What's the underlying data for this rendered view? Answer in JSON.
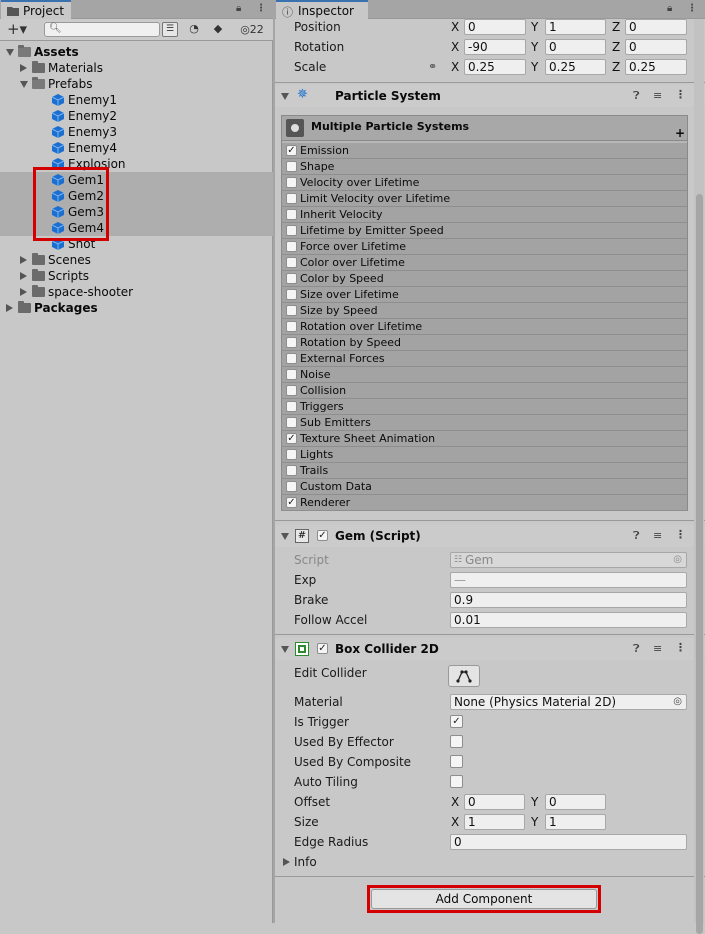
{
  "project_panel": {
    "tab_label": "Project",
    "hidden_count": "22",
    "tree": [
      {
        "label": "Assets",
        "depth": 0,
        "kind": "folder-open",
        "expanded": true,
        "bold": true
      },
      {
        "label": "Materials",
        "depth": 1,
        "kind": "folder",
        "expanded": false
      },
      {
        "label": "Prefabs",
        "depth": 1,
        "kind": "folder-open",
        "expanded": true
      },
      {
        "label": "Enemy1",
        "depth": 2,
        "kind": "prefab"
      },
      {
        "label": "Enemy2",
        "depth": 2,
        "kind": "prefab"
      },
      {
        "label": "Enemy3",
        "depth": 2,
        "kind": "prefab"
      },
      {
        "label": "Enemy4",
        "depth": 2,
        "kind": "prefab"
      },
      {
        "label": "Explosion",
        "depth": 2,
        "kind": "prefab"
      },
      {
        "label": "Gem1",
        "depth": 2,
        "kind": "prefab",
        "selected": true
      },
      {
        "label": "Gem2",
        "depth": 2,
        "kind": "prefab",
        "selected": true
      },
      {
        "label": "Gem3",
        "depth": 2,
        "kind": "prefab",
        "selected": true
      },
      {
        "label": "Gem4",
        "depth": 2,
        "kind": "prefab",
        "selected": true
      },
      {
        "label": "Shot",
        "depth": 2,
        "kind": "prefab"
      },
      {
        "label": "Scenes",
        "depth": 1,
        "kind": "folder",
        "expanded": false
      },
      {
        "label": "Scripts",
        "depth": 1,
        "kind": "folder",
        "expanded": false
      },
      {
        "label": "space-shooter",
        "depth": 1,
        "kind": "folder",
        "expanded": false
      },
      {
        "label": "Packages",
        "depth": 0,
        "kind": "folder",
        "expanded": false,
        "bold": true
      }
    ]
  },
  "inspector": {
    "tab_label": "Inspector",
    "transform": {
      "position_label": "Position",
      "position": {
        "x": "0",
        "y": "1",
        "z": "0"
      },
      "rotation_label": "Rotation",
      "rotation": {
        "x": "-90",
        "y": "0",
        "z": "0"
      },
      "scale_label": "Scale",
      "scale": {
        "x": "0.25",
        "y": "0.25",
        "z": "0.25"
      },
      "axis_x": "X",
      "axis_y": "Y",
      "axis_z": "Z"
    },
    "particle_system": {
      "title": "Particle System",
      "header": "Multiple Particle Systems",
      "modules": [
        {
          "label": "Emission",
          "checked": true
        },
        {
          "label": "Shape",
          "checked": false
        },
        {
          "label": "Velocity over Lifetime",
          "checked": false
        },
        {
          "label": "Limit Velocity over Lifetime",
          "checked": false
        },
        {
          "label": "Inherit Velocity",
          "checked": false
        },
        {
          "label": "Lifetime by Emitter Speed",
          "checked": false
        },
        {
          "label": "Force over Lifetime",
          "checked": false
        },
        {
          "label": "Color over Lifetime",
          "checked": false
        },
        {
          "label": "Color by Speed",
          "checked": false
        },
        {
          "label": "Size over Lifetime",
          "checked": false
        },
        {
          "label": "Size by Speed",
          "checked": false
        },
        {
          "label": "Rotation over Lifetime",
          "checked": false
        },
        {
          "label": "Rotation by Speed",
          "checked": false
        },
        {
          "label": "External Forces",
          "checked": false
        },
        {
          "label": "Noise",
          "checked": false
        },
        {
          "label": "Collision",
          "checked": false
        },
        {
          "label": "Triggers",
          "checked": false
        },
        {
          "label": "Sub Emitters",
          "checked": false
        },
        {
          "label": "Texture Sheet Animation",
          "checked": true
        },
        {
          "label": "Lights",
          "checked": false
        },
        {
          "label": "Trails",
          "checked": false
        },
        {
          "label": "Custom Data",
          "checked": false
        },
        {
          "label": "Renderer",
          "checked": true
        }
      ]
    },
    "gem_script": {
      "title": "Gem (Script)",
      "script_label": "Script",
      "script_value": "Gem",
      "exp_label": "Exp",
      "exp_value": "—",
      "brake_label": "Brake",
      "brake_value": "0.9",
      "follow_label": "Follow Accel",
      "follow_value": "0.01"
    },
    "box_collider": {
      "title": "Box Collider 2D",
      "edit_collider_label": "Edit Collider",
      "material_label": "Material",
      "material_value": "None (Physics Material 2D)",
      "is_trigger_label": "Is Trigger",
      "is_trigger": true,
      "used_by_effector_label": "Used By Effector",
      "used_by_effector": false,
      "used_by_composite_label": "Used By Composite",
      "used_by_composite": false,
      "auto_tiling_label": "Auto Tiling",
      "auto_tiling": false,
      "offset_label": "Offset",
      "offset": {
        "x": "0",
        "y": "0"
      },
      "size_label": "Size",
      "size": {
        "x": "1",
        "y": "1"
      },
      "edge_radius_label": "Edge Radius",
      "edge_radius": "0",
      "info_label": "Info"
    },
    "add_component_label": "Add Component"
  },
  "colors": {
    "highlight": "#d40000",
    "prefab": "#1a6fd0",
    "tab_accent": "#3a72b0"
  }
}
